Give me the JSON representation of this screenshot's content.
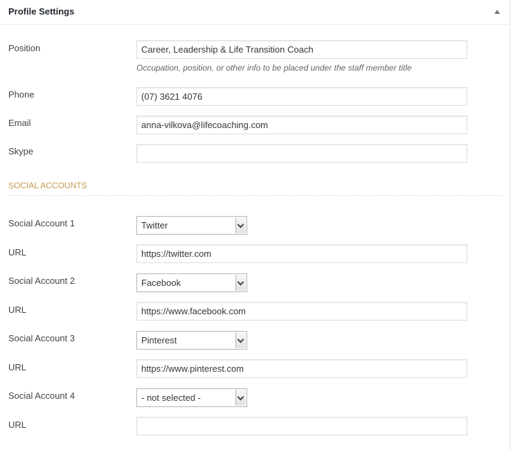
{
  "panel": {
    "title": "Profile Settings"
  },
  "fields": {
    "position": {
      "label": "Position",
      "value": "Career, Leadership & Life Transition Coach",
      "hint": "Occupation, position, or other info to be placed under the staff member title"
    },
    "phone": {
      "label": "Phone",
      "value": "(07) 3621 4076"
    },
    "email": {
      "label": "Email",
      "value": "anna-vilkova@lifecoaching.com"
    },
    "skype": {
      "label": "Skype",
      "value": ""
    }
  },
  "social": {
    "section_title": "SOCIAL ACCOUNTS",
    "accounts": [
      {
        "label": "Social Account 1",
        "selected": "Twitter",
        "url_label": "URL",
        "url": "https://twitter.com"
      },
      {
        "label": "Social Account 2",
        "selected": "Facebook",
        "url_label": "URL",
        "url": "https://www.facebook.com"
      },
      {
        "label": "Social Account 3",
        "selected": "Pinterest",
        "url_label": "URL",
        "url": "https://www.pinterest.com"
      },
      {
        "label": "Social Account 4",
        "selected": "- not selected -",
        "url_label": "URL",
        "url": ""
      }
    ]
  }
}
